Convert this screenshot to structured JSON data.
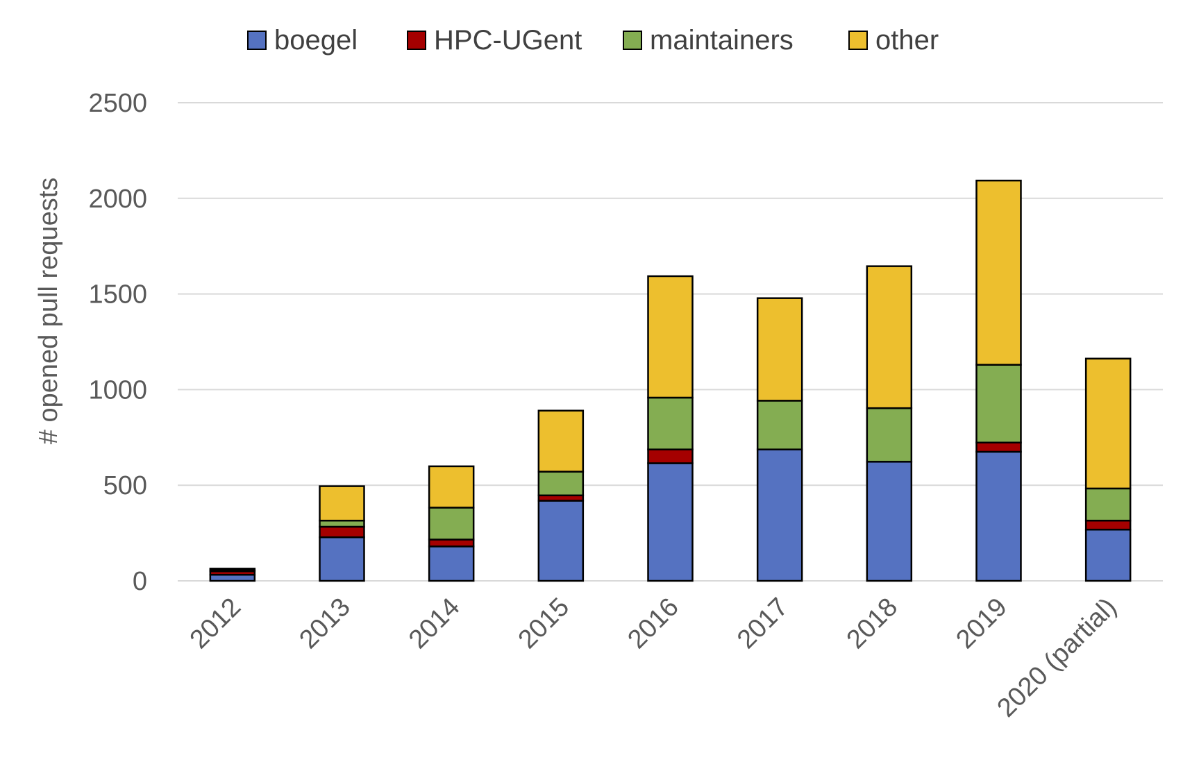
{
  "chart_data": {
    "type": "bar",
    "stacked": true,
    "title": "",
    "xlabel": "",
    "ylabel": "# opened pull requests",
    "ylim": [
      0,
      2500
    ],
    "yticks": [
      0,
      500,
      1000,
      1500,
      2000,
      2500
    ],
    "grid": true,
    "legend_position": "top-center",
    "categories": [
      "2012",
      "2013",
      "2014",
      "2015",
      "2016",
      "2017",
      "2018",
      "2019",
      "2020 (partial)"
    ],
    "series": [
      {
        "name": "boegel",
        "color": "#5572C1",
        "values": [
          32,
          228,
          180,
          419,
          615,
          687,
          623,
          675,
          268
        ]
      },
      {
        "name": "HPC-UGent",
        "color": "#A50000",
        "values": [
          18,
          55,
          36,
          28,
          72,
          0,
          0,
          48,
          47
        ]
      },
      {
        "name": "maintainers",
        "color": "#84AD52",
        "values": [
          5,
          32,
          167,
          124,
          271,
          255,
          280,
          407,
          168
        ]
      },
      {
        "name": "other",
        "color": "#EDBF2E",
        "values": [
          9,
          180,
          216,
          319,
          635,
          536,
          742,
          963,
          679
        ]
      }
    ]
  }
}
